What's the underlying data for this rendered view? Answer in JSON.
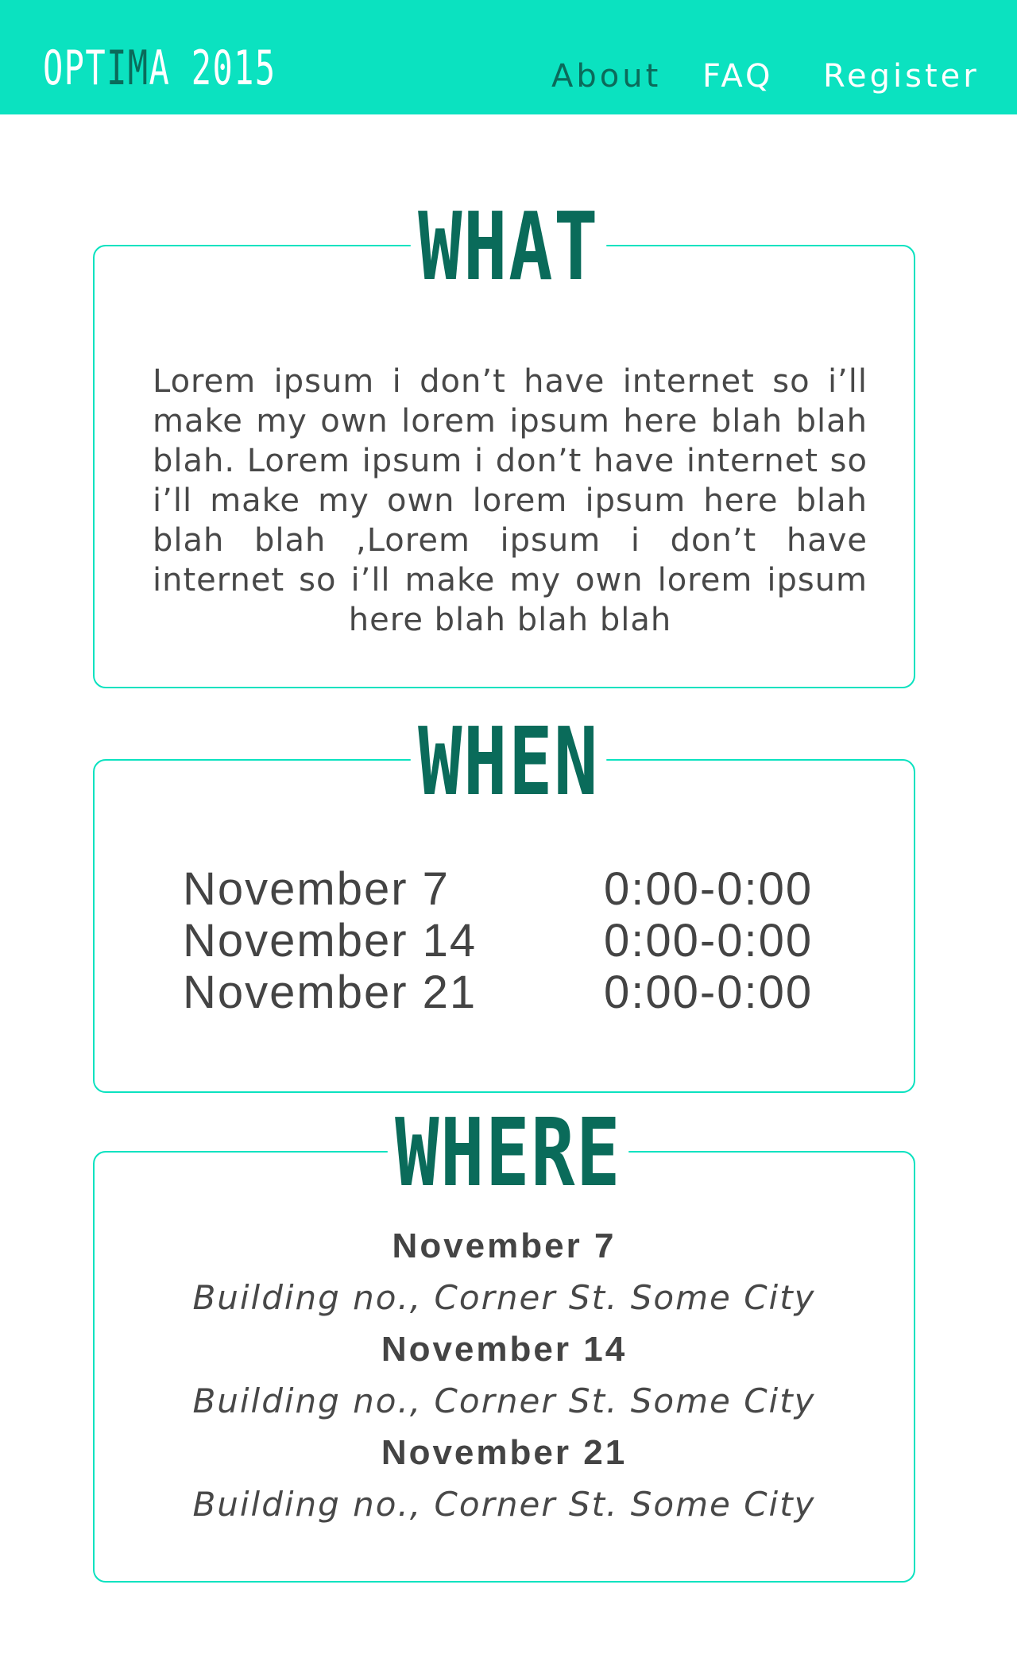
{
  "header": {
    "logo_main": "OPT",
    "logo_accent": "IM",
    "logo_tail": "A 2015",
    "nav": [
      {
        "label": "About"
      },
      {
        "label": "FAQ"
      },
      {
        "label": "Register"
      }
    ]
  },
  "what": {
    "heading": "WHAT",
    "body": "Lorem ipsum i don’t have internet so i’ll make my own lorem ipsum here blah blah blah. Lorem ipsum i don’t have internet so i’ll make my own lorem ipsum here blah blah blah ,Lorem ipsum i don’t have internet so i’ll make my own lorem ipsum here blah blah blah"
  },
  "when": {
    "heading": "WHEN",
    "rows": [
      {
        "date": "November 7",
        "time": "0:00-0:00"
      },
      {
        "date": "November 14",
        "time": "0:00-0:00"
      },
      {
        "date": "November 21",
        "time": "0:00-0:00"
      }
    ]
  },
  "where": {
    "heading": "WHERE",
    "items": [
      {
        "date": "November 7",
        "address": "Building no., Corner St. Some City"
      },
      {
        "date": "November 14",
        "address": "Building no., Corner St. Some City"
      },
      {
        "date": "November 21",
        "address": "Building no., Corner St. Some City"
      }
    ]
  },
  "colors": {
    "header_bg": "#0be2c0",
    "heading_text": "#0a6b5a",
    "body_text": "#484848",
    "border": "#0be2c0"
  }
}
